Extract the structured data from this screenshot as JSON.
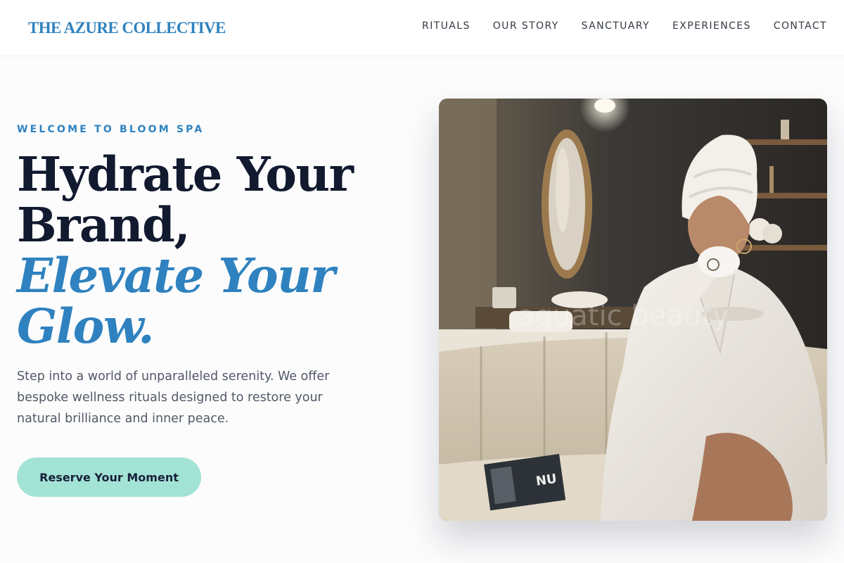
{
  "header": {
    "brand": "THE AZURE COLLECTIVE",
    "nav": [
      "RITUALS",
      "OUR STORY",
      "SANCTUARY",
      "EXPERIENCES",
      "CONTACT"
    ]
  },
  "hero": {
    "eyebrow": "WELCOME TO BLOOM SPA",
    "headline_line1": "Hydrate Your",
    "headline_line2": "Brand,",
    "headline_accent1": "Elevate Your",
    "headline_accent2": "Glow.",
    "lede": "Step into a world of unparalleled serenity. We offer bespoke wellness rituals designed to restore your natural brilliance and inner peace.",
    "cta_label": "Reserve Your Moment"
  },
  "image": {
    "watermark": "aquatic beauty"
  },
  "colors": {
    "accent": "#2f82bf",
    "cta_bg": "#a3e3d5",
    "heading": "#111a2e",
    "body_text": "#515866"
  }
}
